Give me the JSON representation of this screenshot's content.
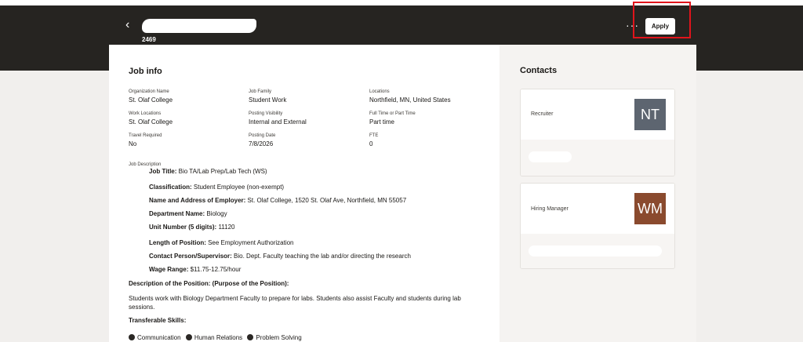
{
  "header": {
    "back_glyph": "‹",
    "title": "",
    "requisition_id": "2469",
    "more_glyph": "···",
    "apply_label": "Apply"
  },
  "job_info": {
    "heading": "Job info",
    "fields": {
      "organization_name": {
        "label": "Organization Name",
        "value": "St. Olaf College"
      },
      "job_family": {
        "label": "Job Family",
        "value": "Student Work"
      },
      "locations": {
        "label": "Locations",
        "value": "Northfield, MN, United States"
      },
      "work_locations": {
        "label": "Work Locations",
        "value": "St. Olaf College"
      },
      "posting_visibility": {
        "label": "Posting Visibility",
        "value": "Internal and External"
      },
      "full_or_part_time": {
        "label": "Full Time or Part Time",
        "value": "Part time"
      },
      "travel_required": {
        "label": "Travel Required",
        "value": "No"
      },
      "posting_date": {
        "label": "Posting Date",
        "value": "7/8/2026"
      },
      "fte": {
        "label": "FTE",
        "value": "0"
      }
    }
  },
  "job_description": {
    "label": "Job Description",
    "lines": [
      {
        "key": "Job Title:",
        "value": " Bio TA/Lab Prep/Lab Tech (WS)"
      },
      {
        "key": "Classification:",
        "value": " Student Employee (non-exempt)"
      },
      {
        "key": "Name and Address of Employer:",
        "value": " St. Olaf College, 1520 St. Olaf Ave, Northfield, MN 55057"
      },
      {
        "key": "Department Name:",
        "value": " Biology"
      },
      {
        "key": "Unit Number (5 digits):",
        "value": " 11120"
      },
      {
        "key": "Length of Position:",
        "value": " See Employment Authorization"
      },
      {
        "key": "Contact Person/Supervisor:",
        "value": " Bio. Dept. Faculty teaching the lab and/or directing the research"
      },
      {
        "key": "Wage Range:",
        "value": " $11.75-12.75/hour"
      }
    ],
    "description_heading": "Description of the Position: (Purpose of the Position):",
    "description_text": "Students work with Biology Department Faculty to prepare for labs. Students also assist Faculty and students during lab sessions.",
    "skills_heading": "Transferable Skills:",
    "skills": [
      "Communication",
      "Human Relations",
      "Problem Solving"
    ]
  },
  "contacts": {
    "heading": "Contacts",
    "items": [
      {
        "role": "Recruiter",
        "initials": "NT",
        "color": "#5d6570"
      },
      {
        "role": "Hiring Manager",
        "initials": "WM",
        "color": "#8a4a2e"
      }
    ]
  }
}
